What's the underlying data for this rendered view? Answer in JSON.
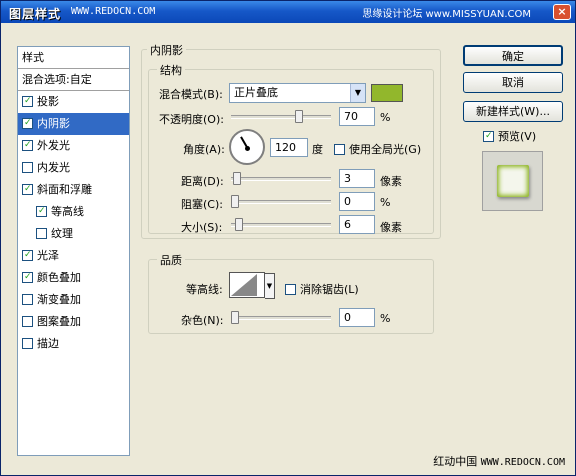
{
  "window": {
    "title": "图层样式",
    "title_url": "WWW.REDOCN.COM",
    "title_right": "思缘设计论坛 www.MISSYUAN.COM",
    "close_label": "×"
  },
  "sidebar": {
    "header": "样式",
    "blend_options": "混合选项:自定",
    "items": [
      {
        "label": "投影",
        "checked": true,
        "selected": false,
        "sub": false
      },
      {
        "label": "内阴影",
        "checked": true,
        "selected": true,
        "sub": false
      },
      {
        "label": "外发光",
        "checked": true,
        "selected": false,
        "sub": false
      },
      {
        "label": "内发光",
        "checked": false,
        "selected": false,
        "sub": false
      },
      {
        "label": "斜面和浮雕",
        "checked": true,
        "selected": false,
        "sub": false
      },
      {
        "label": "等高线",
        "checked": true,
        "selected": false,
        "sub": true
      },
      {
        "label": "纹理",
        "checked": false,
        "selected": false,
        "sub": true
      },
      {
        "label": "光泽",
        "checked": true,
        "selected": false,
        "sub": false
      },
      {
        "label": "颜色叠加",
        "checked": true,
        "selected": false,
        "sub": false
      },
      {
        "label": "渐变叠加",
        "checked": false,
        "selected": false,
        "sub": false
      },
      {
        "label": "图案叠加",
        "checked": false,
        "selected": false,
        "sub": false
      },
      {
        "label": "描边",
        "checked": false,
        "selected": false,
        "sub": false
      }
    ]
  },
  "inner_shadow": {
    "group_title": "内阴影",
    "structure_title": "结构",
    "blend_mode_label": "混合模式(B):",
    "blend_mode_value": "正片叠底",
    "color": "#92b72c",
    "opacity_label": "不透明度(O):",
    "opacity_value": "70",
    "opacity_unit": "%",
    "opacity_level": 0.7,
    "angle_label": "角度(A):",
    "angle_value": "120",
    "angle_unit": "度",
    "global_light_label": "使用全局光(G)",
    "global_light_checked": false,
    "distance_label": "距离(D):",
    "distance_value": "3",
    "distance_unit": "像素",
    "choke_label": "阻塞(C):",
    "choke_value": "0",
    "choke_unit": "%",
    "size_label": "大小(S):",
    "size_value": "6",
    "size_unit": "像素"
  },
  "quality": {
    "group_title": "品质",
    "contour_label": "等高线:",
    "antialias_label": "消除锯齿(L)",
    "antialias_checked": false,
    "noise_label": "杂色(N):",
    "noise_value": "0",
    "noise_unit": "%"
  },
  "buttons": {
    "ok": "确定",
    "cancel": "取消",
    "new_style": "新建样式(W)...",
    "preview_label": "预览(V)",
    "preview_checked": true
  },
  "footer": {
    "site": "红动中国",
    "url": "WWW.REDOCN.COM"
  }
}
